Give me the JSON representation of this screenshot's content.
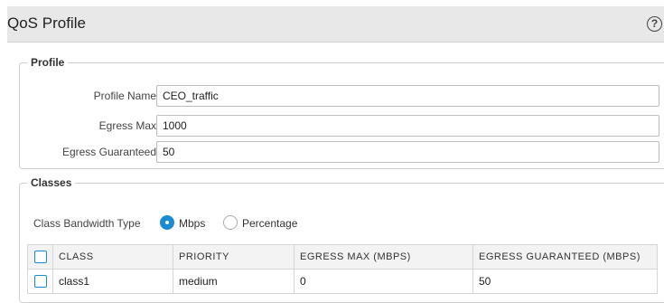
{
  "header": {
    "title": "QoS Profile",
    "help_icon": "help-icon"
  },
  "profile": {
    "legend": "Profile",
    "fields": [
      {
        "label": "Profile Name",
        "value": "CEO_traffic"
      },
      {
        "label": "Egress Max",
        "value": "1000"
      },
      {
        "label": "Egress Guaranteed",
        "value": "50"
      }
    ]
  },
  "classes": {
    "legend": "Classes",
    "bandwidth_type": {
      "label": "Class Bandwidth Type",
      "options": [
        "Mbps",
        "Percentage"
      ],
      "selected": "Mbps"
    },
    "table": {
      "columns": [
        "CLASS",
        "PRIORITY",
        "EGRESS MAX (MBPS)",
        "EGRESS GUARANTEED (MBPS)"
      ],
      "rows": [
        {
          "class": "class1",
          "priority": "medium",
          "egress_max": "0",
          "egress_guaranteed": "50"
        }
      ]
    }
  },
  "colors": {
    "accent": "#1a8ad4",
    "header_bg": "#e8e8e8",
    "border": "#cfcfcf"
  }
}
